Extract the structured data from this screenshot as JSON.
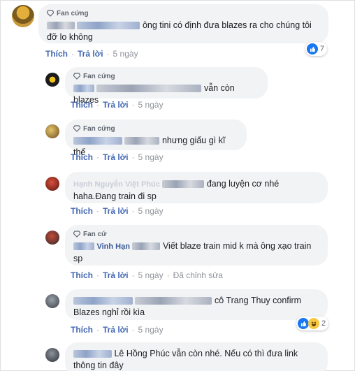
{
  "badge_label": "Fan cứng",
  "badge_label_cut": "Fan cứ",
  "actions": {
    "like": "Thích",
    "reply": "Trả lời",
    "dot": "·",
    "time": "5 ngày",
    "edited": "Đã chỉnh sửa"
  },
  "comments": [
    {
      "text": "ông tini có định đưa blazes ra cho chúng tôi đỡ lo không",
      "reactions": "7"
    },
    {
      "text": "vẫn còn blazes"
    },
    {
      "text": "nhưng giấu gì kĩ thế"
    },
    {
      "name_fragment": "Hạnh Nguyễn Việt Phúc",
      "text_a": "đang luyện cơ nhé",
      "text_b": "haha.Đang train đi sp"
    },
    {
      "name_fragment": "Vinh Hạn",
      "text": "Viết blaze train mid k mà ông xạo train sp"
    },
    {
      "text": "cô Trang Thuy confirm Blazes nghỉ rồi kìa",
      "reactions": "2"
    },
    {
      "text": "Lê Hồng Phúc vẫn còn nhé. Nếu có thì đưa link thông tin đây"
    }
  ],
  "colors": {
    "link": "#4267b2",
    "bubble": "#f2f3f5",
    "muted": "#90949c",
    "like_blue": "#1877f2"
  },
  "icons": [
    "diamond-icon",
    "like-reaction-icon",
    "haha-reaction-icon",
    "avatar"
  ]
}
